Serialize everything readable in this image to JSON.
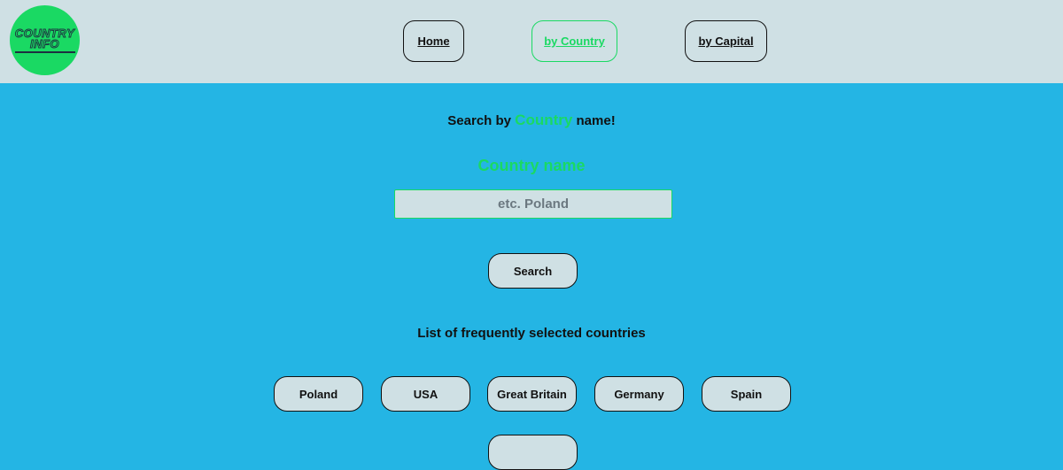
{
  "header": {
    "logo": {
      "line1": "COUNTRY",
      "line2": "INFO"
    },
    "nav": {
      "home": "Home",
      "by_country": "by Country",
      "by_capital": "by Capital"
    }
  },
  "main": {
    "heading": {
      "prefix": "Search by ",
      "accent": "Country",
      "suffix": " name!"
    },
    "field_label": "Country name",
    "search_placeholder": "etc. Poland",
    "search_button": "Search",
    "list_title": "List of frequently selected countries",
    "countries": [
      "Poland",
      "USA",
      "Great Britain",
      "Germany",
      "Spain"
    ]
  },
  "colors": {
    "header_bg": "#cfe0e4",
    "page_bg": "#24b5e4",
    "accent": "#1ad963",
    "button_bg": "#cfe0e4"
  }
}
